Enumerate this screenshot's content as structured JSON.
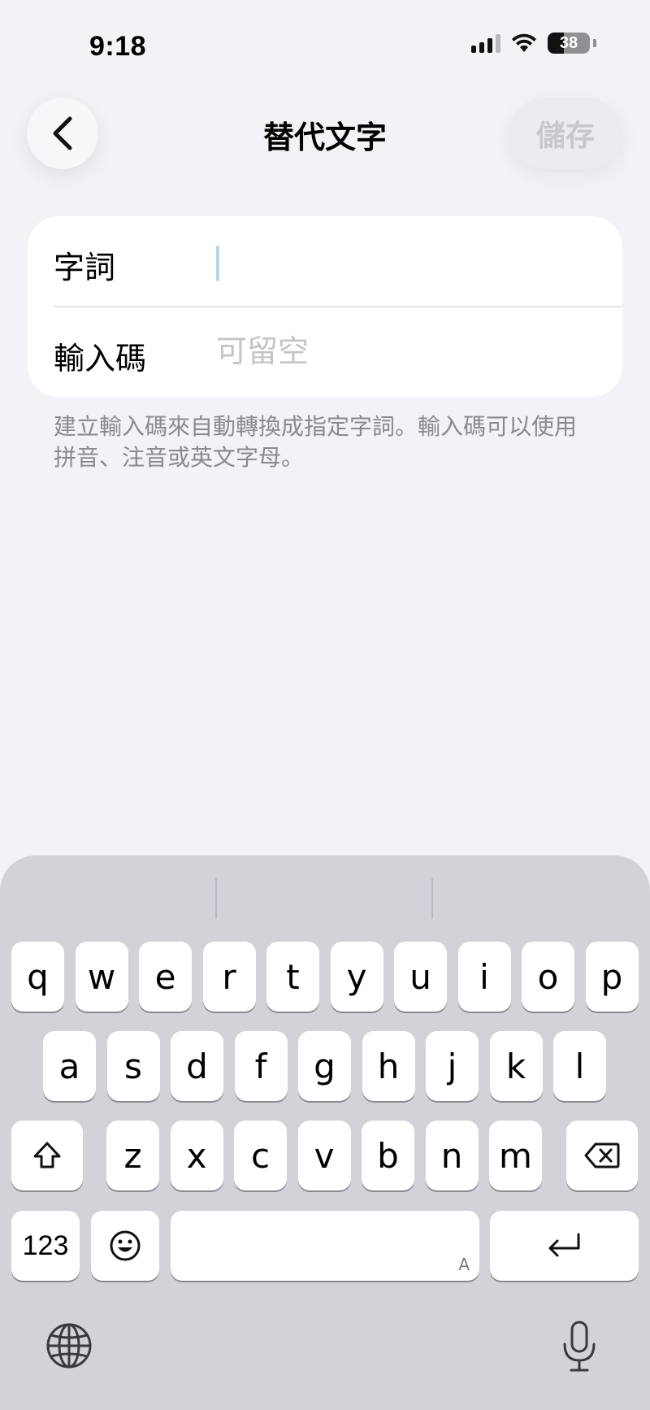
{
  "status_bar": {
    "time": "9:18",
    "battery_text": "38",
    "battery_level": 0.38
  },
  "nav": {
    "back_icon": "chevron-left-icon",
    "title": "替代文字",
    "save_label": "儲存"
  },
  "form": {
    "phrase_label": "字詞",
    "phrase_value": "",
    "shortcut_label": "輸入碼",
    "shortcut_placeholder": "可留空",
    "shortcut_value": ""
  },
  "helper_text": "建立輸入碼來自動轉換成指定字詞。輸入碼可以使用拼音、注音或英文字母。",
  "keyboard": {
    "row1": [
      "q",
      "w",
      "e",
      "r",
      "t",
      "y",
      "u",
      "i",
      "o",
      "p"
    ],
    "row2": [
      "a",
      "s",
      "d",
      "f",
      "g",
      "h",
      "j",
      "k",
      "l"
    ],
    "row3": [
      "z",
      "x",
      "c",
      "v",
      "b",
      "n",
      "m"
    ],
    "numbers_label": "123",
    "space_hint": "A",
    "icons": {
      "shift": "shift-icon",
      "delete": "backspace-icon",
      "emoji": "emoji-icon",
      "return": "return-icon",
      "globe": "globe-icon",
      "mic": "microphone-icon"
    }
  },
  "colors": {
    "background": "#f2f2f7",
    "keyboard_bg": "#d1d3d9",
    "caret": "#b5d4ea",
    "placeholder": "#c4c4c9",
    "disabled_text": "#c7c7cc"
  }
}
